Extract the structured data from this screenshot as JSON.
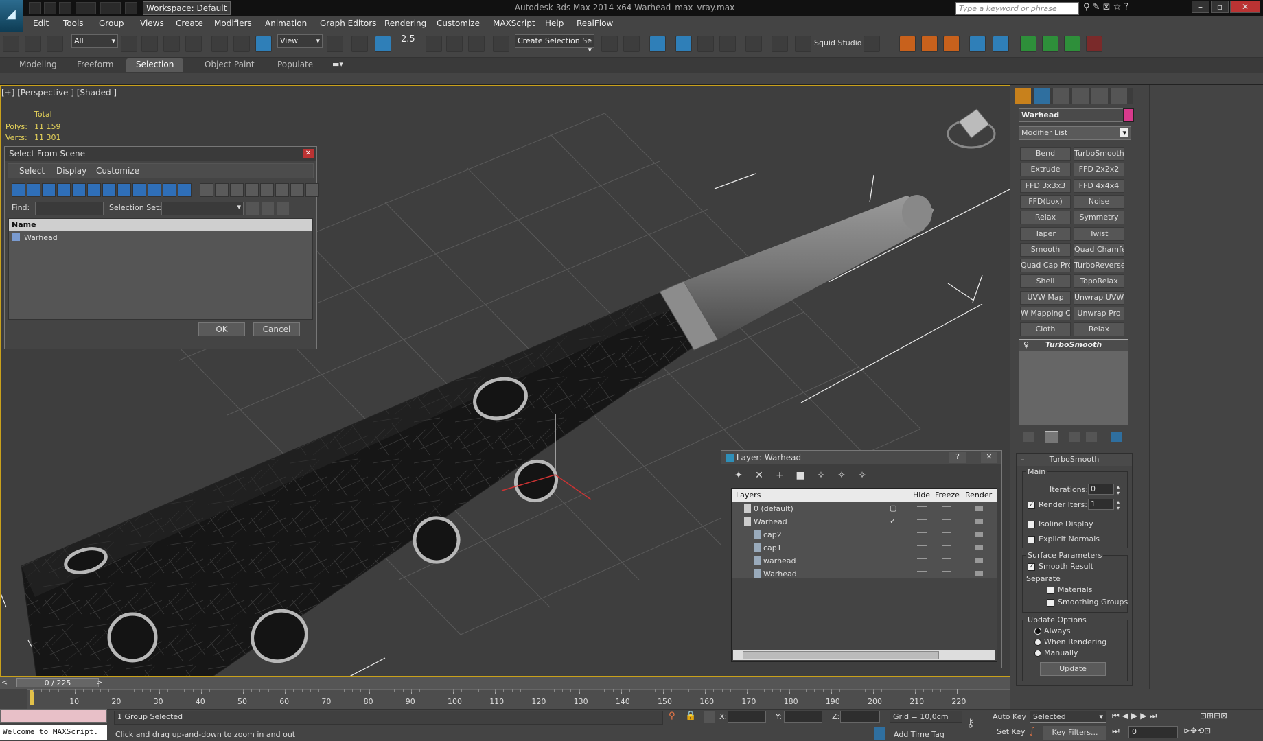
{
  "title_bar": {
    "workspace": "Workspace: Default",
    "window_title": "Autodesk 3ds Max  2014 x64     Warhead_max_vray.max",
    "search_placeholder": "Type a keyword or phrase"
  },
  "menu": [
    "Edit",
    "Tools",
    "Group",
    "Views",
    "Create",
    "Modifiers",
    "Animation",
    "Graph Editors",
    "Rendering",
    "Customize",
    "MAXScript",
    "Help",
    "RealFlow"
  ],
  "toolbar": {
    "filter": "All",
    "ref_coord": "View",
    "snap_value": "2.5",
    "selection_set": "Create Selection Se",
    "plugin_label": "Squid Studio v"
  },
  "ribbon_tabs": [
    "Modeling",
    "Freeform",
    "Selection",
    "Object Paint",
    "Populate"
  ],
  "viewport": {
    "label": "[+] [Perspective ] [Shaded ]",
    "stats_header": "Total",
    "polys_label": "Polys:",
    "polys_value": "11 159",
    "verts_label": "Verts:",
    "verts_value": "11 301"
  },
  "select_dialog": {
    "title": "Select From Scene",
    "menus": [
      "Select",
      "Display",
      "Customize"
    ],
    "find_label": "Find:",
    "selection_set_label": "Selection Set:",
    "column": "Name",
    "items": [
      "Warhead"
    ],
    "ok": "OK",
    "cancel": "Cancel"
  },
  "layer_dialog": {
    "title": "Layer: Warhead",
    "columns": [
      "Layers",
      "Hide",
      "Freeze",
      "Render"
    ],
    "rows": [
      {
        "name": "0 (default)",
        "indent": 1
      },
      {
        "name": "Warhead",
        "indent": 1
      },
      {
        "name": "cap2",
        "indent": 2
      },
      {
        "name": "cap1",
        "indent": 2
      },
      {
        "name": "warhead",
        "indent": 2
      },
      {
        "name": "Warhead",
        "indent": 2
      }
    ]
  },
  "command_panel": {
    "object_name": "Warhead",
    "object_color": "#d83a8c",
    "modifier_list": "Modifier List",
    "modifiers": [
      "Bend",
      "TurboSmooth",
      "Extrude",
      "FFD 2x2x2",
      "FFD 3x3x3",
      "FFD 4x4x4",
      "FFD(box)",
      "Noise",
      "Relax",
      "Symmetry",
      "Taper",
      "Twist",
      "Smooth",
      "Quad Chamfer",
      "Quad Cap Pro",
      "TurboReverse",
      "Shell",
      "TopoRelax",
      "UVW Map",
      "Unwrap UVW",
      "W Mapping Cle",
      "Unwrap Pro",
      "Cloth",
      "Relax"
    ],
    "stack_item": "TurboSmooth",
    "rollout_title": "TurboSmooth",
    "main_label": "Main",
    "iterations_label": "Iterations:",
    "iterations_value": "0",
    "render_iters_label": "Render Iters:",
    "render_iters_value": "1",
    "isoline": "Isoline Display",
    "explicit_normals": "Explicit Normals",
    "surface_params": "Surface Parameters",
    "smooth_result": "Smooth Result",
    "separate": "Separate",
    "materials": "Materials",
    "smoothing_groups": "Smoothing Groups",
    "update_options": "Update Options",
    "always": "Always",
    "when_rendering": "When Rendering",
    "manually": "Manually",
    "update": "Update"
  },
  "timeline": {
    "frame": "0 / 225",
    "ticks": [
      "10",
      "20",
      "30",
      "40",
      "50",
      "60",
      "70",
      "80",
      "90",
      "100",
      "110",
      "120",
      "130",
      "140",
      "150",
      "160",
      "170",
      "180",
      "190",
      "200",
      "210",
      "220"
    ]
  },
  "status": {
    "maxscript": "Welcome to MAXScript.",
    "selected": "1 Group Selected",
    "prompt": "Click and drag up-and-down to zoom in and out",
    "x_label": "X:",
    "y_label": "Y:",
    "z_label": "Z:",
    "grid": "Grid = 10,0cm",
    "add_time_tag": "Add Time Tag",
    "auto_key": "Auto Key",
    "selected_dropdown": "Selected",
    "set_key": "Set Key",
    "key_filters": "Key Filters...",
    "frame_field": "0"
  }
}
